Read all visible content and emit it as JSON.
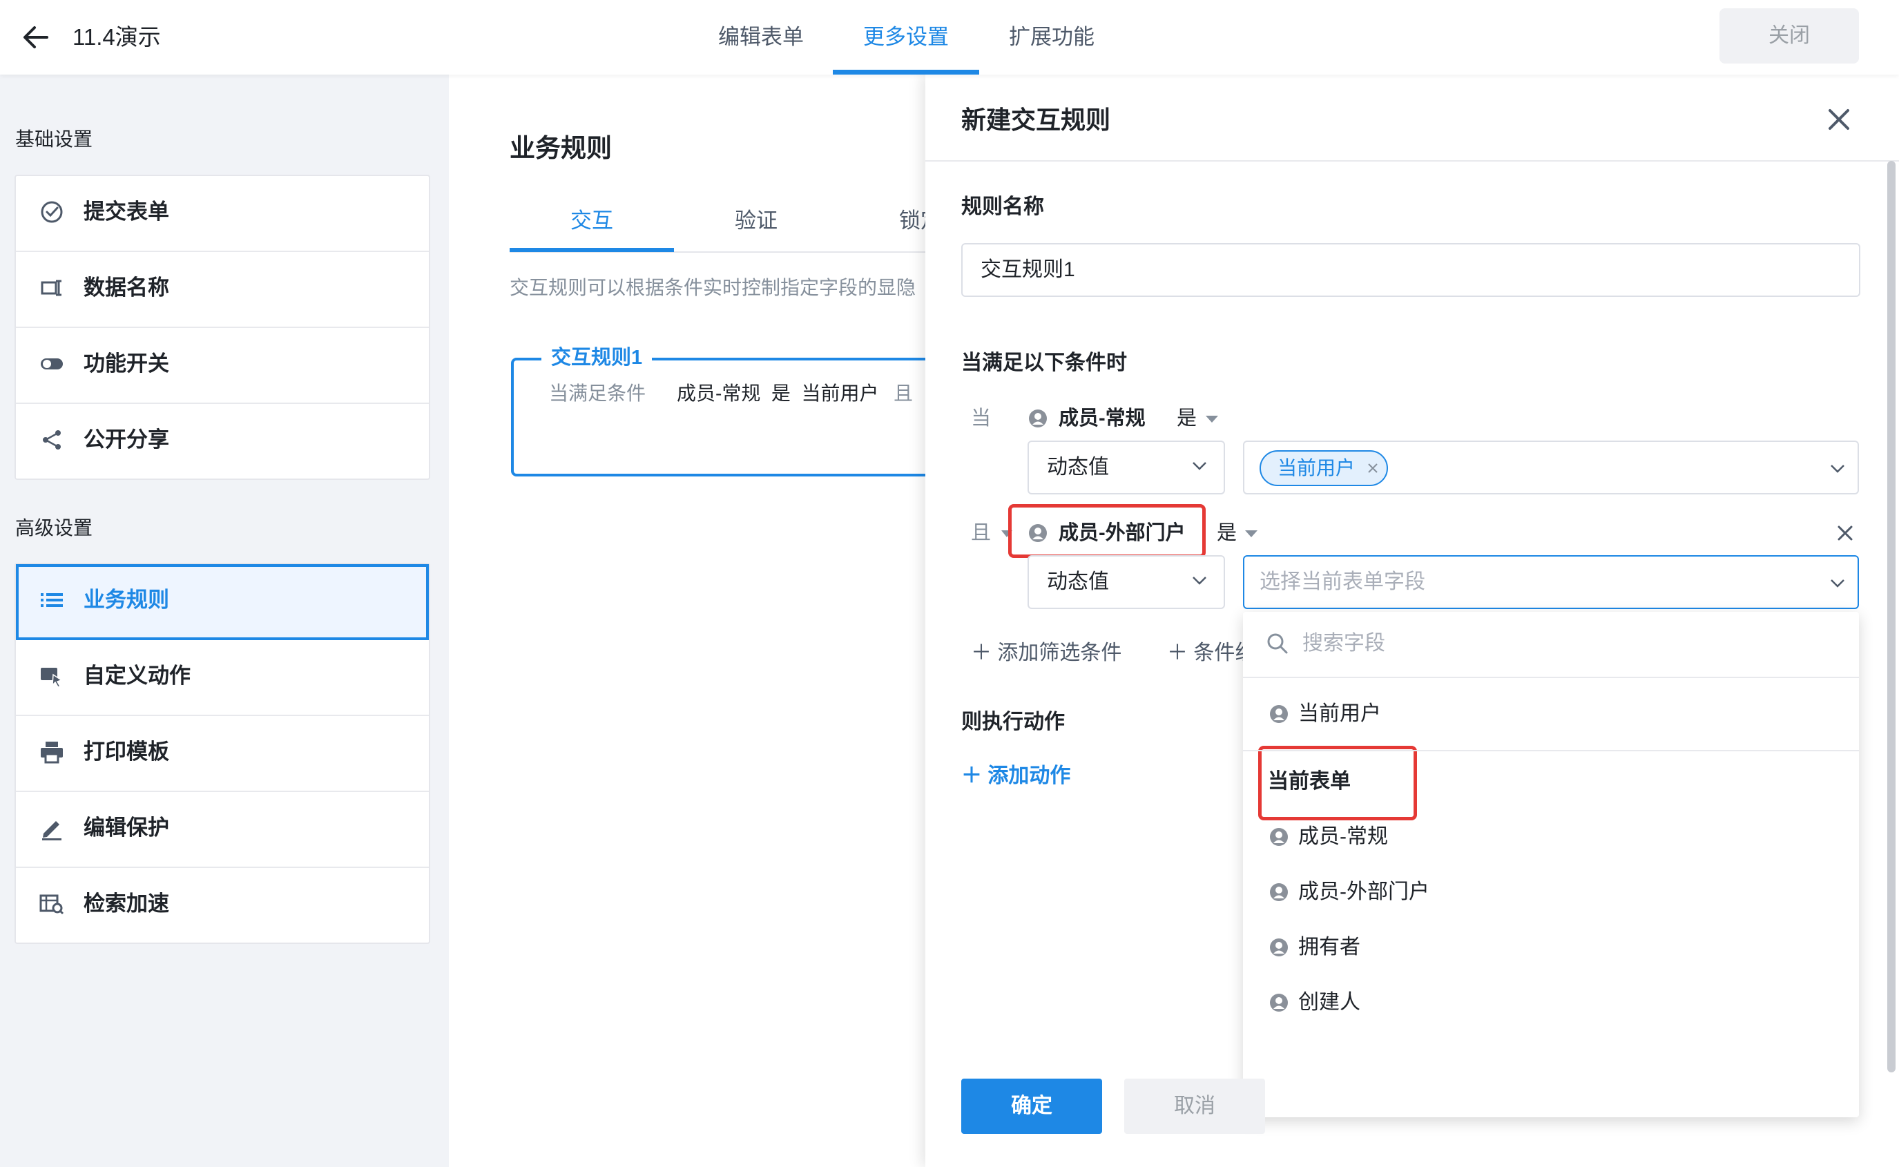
{
  "header": {
    "title": "11.4演示",
    "tabs": [
      {
        "label": "编辑表单",
        "active": false
      },
      {
        "label": "更多设置",
        "active": true
      },
      {
        "label": "扩展功能",
        "active": false
      }
    ],
    "close_label": "关闭"
  },
  "sidebar": {
    "basic_heading": "基础设置",
    "basic_items": [
      {
        "label": "提交表单",
        "icon": "check-circle-icon"
      },
      {
        "label": "数据名称",
        "icon": "label-icon"
      },
      {
        "label": "功能开关",
        "icon": "toggle-icon"
      },
      {
        "label": "公开分享",
        "icon": "share-icon"
      }
    ],
    "advanced_heading": "高级设置",
    "advanced_items": [
      {
        "label": "业务规则",
        "icon": "list-icon",
        "active": true
      },
      {
        "label": "自定义动作",
        "icon": "cursor-icon"
      },
      {
        "label": "打印模板",
        "icon": "printer-icon"
      },
      {
        "label": "编辑保护",
        "icon": "pen-icon"
      },
      {
        "label": "检索加速",
        "icon": "search-speed-icon"
      }
    ]
  },
  "center": {
    "title": "业务规则",
    "subtabs": [
      "交互",
      "验证",
      "锁定"
    ],
    "description": "交互规则可以根据条件实时控制指定字段的显隐",
    "rule_card": {
      "title": "交互规则1",
      "condition_label": "当满足条件",
      "condition_text": "成员-常规  是  当前用户",
      "and_label": "且"
    }
  },
  "drawer": {
    "title": "新建交互规则",
    "rule_name_label": "规则名称",
    "rule_name_value": "交互规则1",
    "conditions_label": "当满足以下条件时",
    "conditions": [
      {
        "prefix": "当",
        "field": "成员-常规",
        "operator": "是",
        "value_type": "动态值",
        "value_tag": "当前用户"
      },
      {
        "prefix": "且",
        "field": "成员-外部门户",
        "operator": "是",
        "value_type": "动态值",
        "value_placeholder": "选择当前表单字段"
      }
    ],
    "add_filter_label": "添加筛选条件",
    "add_group_label": "条件组",
    "actions_label": "则执行动作",
    "add_action_label": "添加动作",
    "confirm_label": "确定",
    "cancel_label": "取消",
    "dropdown": {
      "search_placeholder": "搜索字段",
      "current_user": "当前用户",
      "section_label": "当前表单",
      "items": [
        "成员-常规",
        "成员-外部门户",
        "拥有者",
        "创建人"
      ]
    }
  },
  "colors": {
    "accent": "#1e88e5",
    "highlight": "#e53935"
  }
}
